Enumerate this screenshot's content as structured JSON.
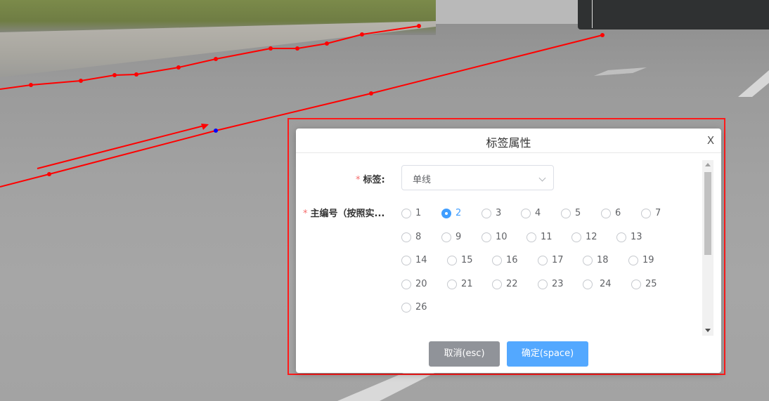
{
  "dialog": {
    "title": "标签属性",
    "close_label": "X",
    "fields": {
      "label": {
        "name": "标签:",
        "value": "单线"
      },
      "main_number": {
        "name": "主编号（按照实...",
        "options": [
          "1",
          "2",
          "3",
          "4",
          "5",
          "6",
          "7",
          "8",
          "9",
          "10",
          "11",
          "12",
          "13",
          "14",
          "15",
          "16",
          "17",
          "18",
          "19",
          "20",
          "21",
          "22",
          "23",
          "24",
          "25",
          "26"
        ],
        "selected": "2"
      }
    },
    "buttons": {
      "cancel": "取消(esc)",
      "ok": "确定(space)"
    }
  },
  "colors": {
    "accent": "#409eff",
    "cancel_button": "#909399",
    "ok_button": "#53a8ff",
    "annotation_line": "#ff0000",
    "selected_point": "#0000ff"
  }
}
